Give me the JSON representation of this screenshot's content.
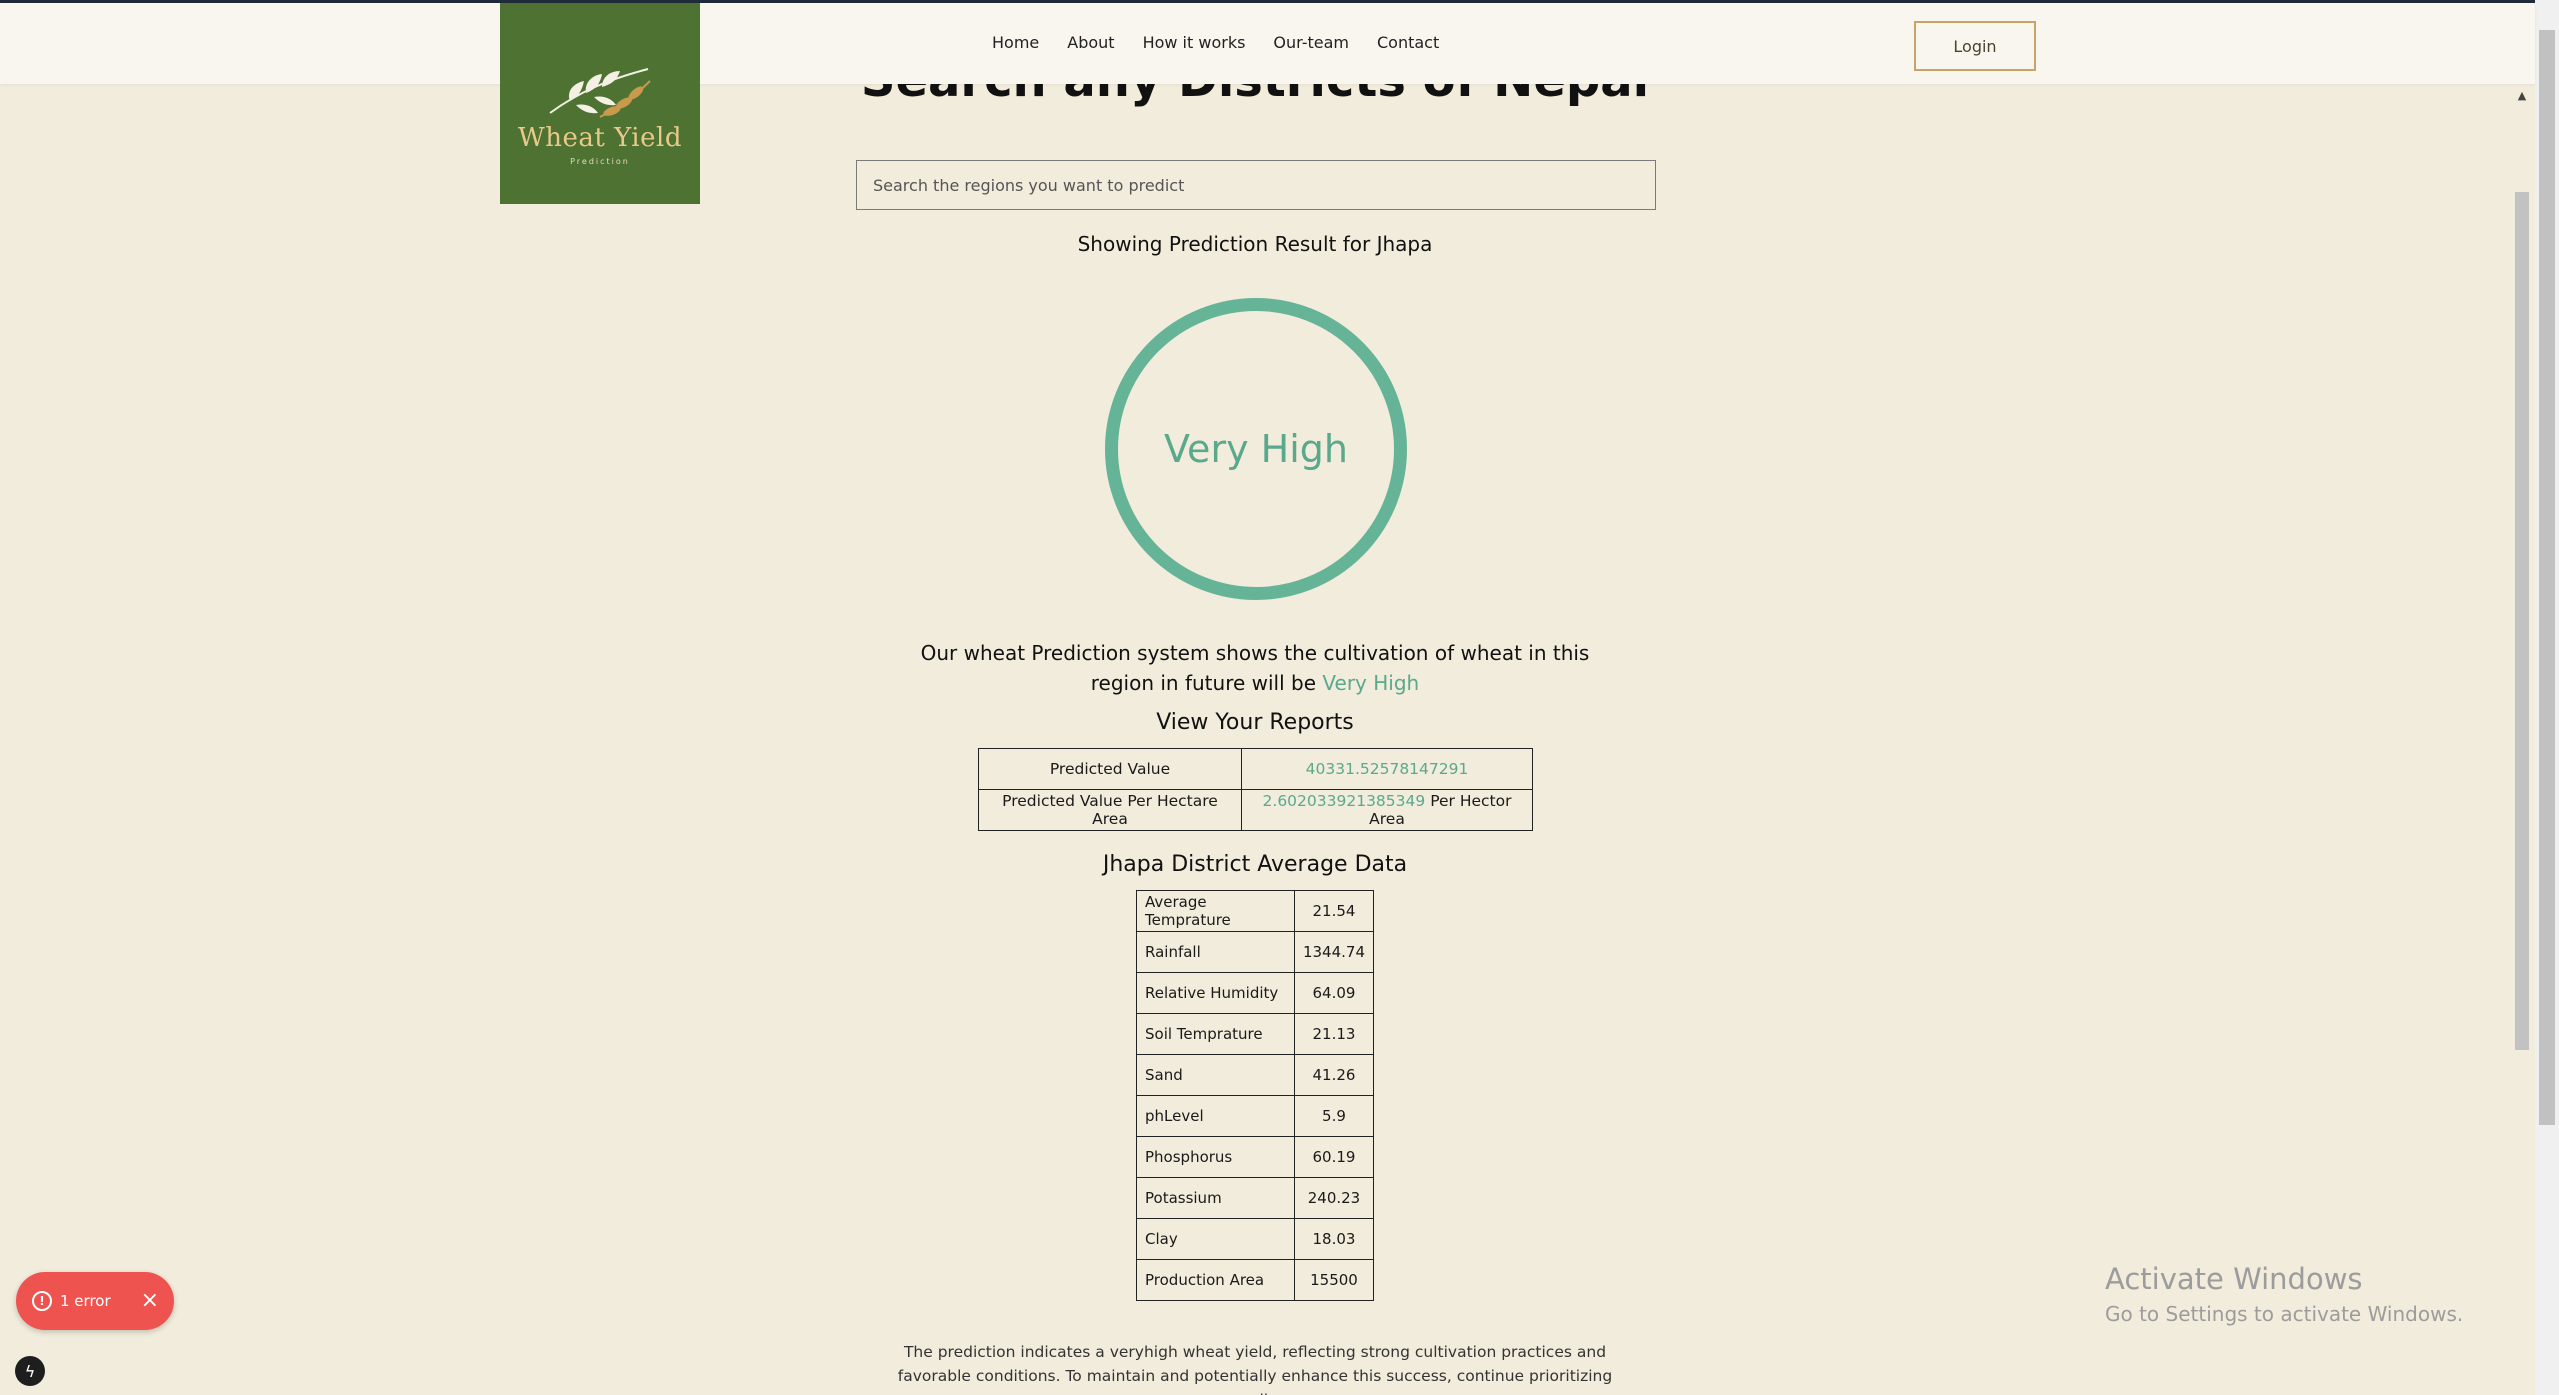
{
  "header": {
    "logo_title": "Wheat Yield",
    "logo_subtitle": "Prediction",
    "nav": [
      "Home",
      "About",
      "How it works",
      "Our-team",
      "Contact"
    ],
    "login_label": "Login"
  },
  "main": {
    "page_title": "Search any Districts of Nepal",
    "search_placeholder": "Search the regions you want to predict",
    "result_heading": "Showing Prediction Result for Jhapa",
    "prediction_level": "Very High",
    "statement_prefix": "Our wheat Prediction system shows the cultivation of wheat in this region in future will be",
    "statement_level": "Very High",
    "reports_heading": "View Your Reports",
    "reports": [
      {
        "label": "Predicted Value",
        "value": "40331.52578147291",
        "suffix": ""
      },
      {
        "label": "Predicted Value Per Hectare Area",
        "value": "2.602033921385349",
        "suffix": "Per Hector Area"
      }
    ],
    "district_heading": "Jhapa District Average Data",
    "averages": [
      {
        "label": "Average Temprature",
        "value": "21.54"
      },
      {
        "label": "Rainfall",
        "value": "1344.74"
      },
      {
        "label": "Relative Humidity",
        "value": "64.09"
      },
      {
        "label": "Soil Temprature",
        "value": "21.13"
      },
      {
        "label": "Sand",
        "value": "41.26"
      },
      {
        "label": "phLevel",
        "value": "5.9"
      },
      {
        "label": "Phosphorus",
        "value": "60.19"
      },
      {
        "label": "Potassium",
        "value": "240.23"
      },
      {
        "label": "Clay",
        "value": "18.03"
      },
      {
        "label": "Production Area",
        "value": "15500"
      }
    ],
    "description": "The prediction indicates a veryhigh wheat yield, reflecting strong cultivation practices and favorable conditions. To maintain and potentially enhance this success, continue prioritizing soil"
  },
  "overlay": {
    "error_label": "1 error",
    "activate_title": "Activate Windows",
    "activate_sub": "Go to Settings to activate Windows."
  },
  "colors": {
    "background": "#f1ecdb",
    "accent_green": "#5aa98c",
    "logo_green": "#4d7232",
    "login_border": "#c8a36a",
    "error_red": "#ef5350"
  },
  "icons": [
    "wheat-logo-icon",
    "error-circle-icon",
    "close-icon",
    "bolt-icon",
    "scroll-up-arrow-icon"
  ]
}
